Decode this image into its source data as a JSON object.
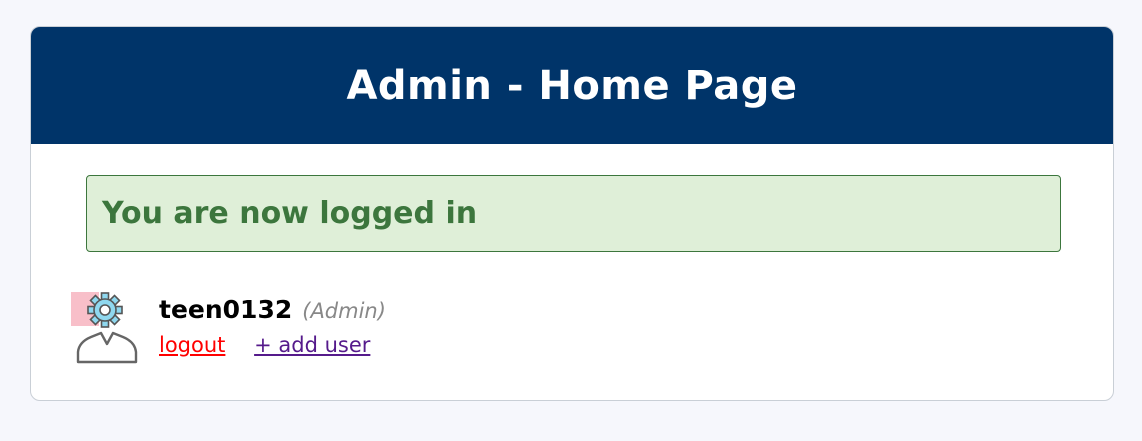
{
  "header": {
    "title": "Admin - Home Page",
    "background_color": "#003469"
  },
  "alert": {
    "message": "You are now logged in",
    "background_color": "#dfefd8",
    "text_color": "#3c763d"
  },
  "profile": {
    "avatar_icon": "admin-user-gear-icon",
    "username": "teen0132",
    "role": "(Admin)",
    "links": {
      "logout": "logout",
      "add_user": "+ add user"
    },
    "logout_color": "#ff0000",
    "add_user_color": "#551a8b"
  }
}
